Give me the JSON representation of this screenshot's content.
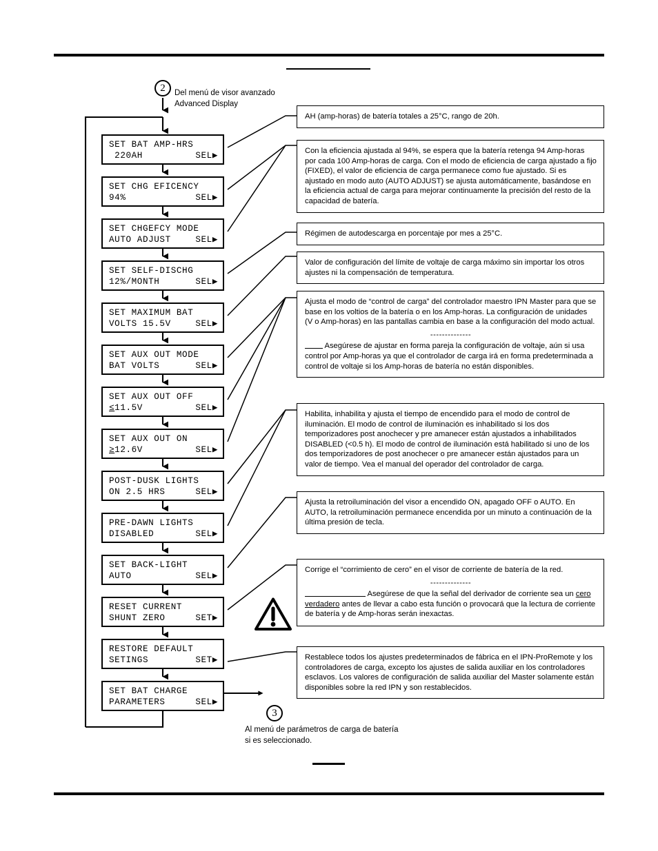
{
  "page": {
    "entry_marker": "2",
    "exit_marker": "3",
    "entry_caption": "Del menú de visor avanzado\nAdvanced Display",
    "exit_caption": "Al menú de parámetros de carga de batería\nsi es seleccionado."
  },
  "lcd_screens": [
    {
      "name": "set-bat-amp-hrs",
      "line1": "SET BAT AMP-HRS",
      "line2_prefix": "",
      "line2": " 220AH",
      "action": "SEL▶"
    },
    {
      "name": "set-chg-eficency",
      "line1": "SET CHG EFICENCY",
      "line2_prefix": "",
      "line2": "94%",
      "action": "SEL▶"
    },
    {
      "name": "set-chgefcy-mode",
      "line1": "SET CHGEFCY MODE",
      "line2_prefix": "",
      "line2": "AUTO ADJUST",
      "action": "SEL▶"
    },
    {
      "name": "set-self-dischg",
      "line1": "SET SELF-DISCHG",
      "line2_prefix": "",
      "line2": "12%/MONTH",
      "action": "SEL▶"
    },
    {
      "name": "set-maximum-bat",
      "line1": "SET MAXIMUM BAT",
      "line2_prefix": "",
      "line2": "VOLTS 15.5V",
      "action": "SEL▶"
    },
    {
      "name": "set-aux-out-mode",
      "line1": "SET AUX OUT MODE",
      "line2_prefix": "",
      "line2": "BAT VOLTS",
      "action": "SEL▶"
    },
    {
      "name": "set-aux-out-off",
      "line1": "SET AUX OUT OFF",
      "line2_prefix": "≤",
      "line2": "11.5V",
      "action": "SEL▶"
    },
    {
      "name": "set-aux-out-on",
      "line1": "SET AUX OUT ON",
      "line2_prefix": "≥",
      "line2": "12.6V",
      "action": "SEL▶"
    },
    {
      "name": "post-dusk-lights",
      "line1": "POST-DUSK LIGHTS",
      "line2_prefix": "",
      "line2": "ON 2.5 HRS",
      "action": "SEL▶"
    },
    {
      "name": "pre-dawn-lights",
      "line1": "PRE-DAWN LIGHTS",
      "line2_prefix": "",
      "line2": "DISABLED",
      "action": "SEL▶"
    },
    {
      "name": "set-back-light",
      "line1": "SET BACK-LIGHT",
      "line2_prefix": "",
      "line2": "AUTO",
      "action": "SEL▶"
    },
    {
      "name": "reset-current-shunt",
      "line1": "RESET CURRENT",
      "line2_prefix": "",
      "line2": "SHUNT ZERO",
      "action": "SET▶"
    },
    {
      "name": "restore-default",
      "line1": "RESTORE DEFAULT",
      "line2_prefix": "",
      "line2": "SETINGS",
      "action": "SET▶"
    },
    {
      "name": "set-bat-charge",
      "line1": "SET BAT CHARGE",
      "line2_prefix": "",
      "line2": "PARAMETERS",
      "action": "SEL▶"
    }
  ],
  "descriptions": {
    "amp_hours": {
      "p1": "AH (amp-horas) de batería totales a 25°C, rango de 20h."
    },
    "charge_efficiency": {
      "p1": "Con la eficiencia ajustada al 94%, se espera que la batería retenga 94 Amp-horas por cada 100 Amp-horas de carga. Con el modo de eficiencia de carga ajustado a fijo (FIXED), el valor de eficiencia de carga permanece como fue ajustado. Si es ajustado en modo auto (AUTO ADJUST) se ajusta automáticamente, basándose en la eficiencia actual de carga para mejorar continuamente la precisión del resto de la capacidad de batería."
    },
    "self_discharge": {
      "p1": "Régimen de autodescarga en porcentaje por mes a 25°C."
    },
    "maximum_bat_volts": {
      "p1": "Valor de configuración del límite de voltaje de carga máximo sin importar los otros ajustes ni la compensación de temperatura."
    },
    "aux_out_mode": {
      "p1": "Ajusta el modo de “control de carga” del controlador maestro IPN Master para que se base en los voltios de la batería o en los Amp-horas. La configuración de unidades (V o Amp-horas) en las pantallas cambia en base a la configuración del modo actual.",
      "separator": "--------------",
      "p2": "Asegúrese de ajustar en forma pareja la configuración de voltaje, aún si usa control por Amp-horas ya que el controlador de carga irá en forma predeterminada a control de voltaje si los Amp-horas de batería no están disponibles."
    },
    "lights_control": {
      "p1": "Habilita, inhabilita y ajusta el tiempo de encendido para el modo de control de iluminación. El modo de control de iluminación es inhabilitado si los dos temporizadores post anochecer y pre amanecer están ajustados a inhabilitados DISABLED (<0.5 h). El modo de control de iluminación está habilitado si uno de los dos temporizadores de post anochecer o pre amanecer están ajustados para un valor de tiempo. Vea el manual del operador del controlador de carga."
    },
    "back_light": {
      "p1": "Ajusta la retroiluminación del visor a encendido ON, apagado OFF o AUTO. En AUTO, la retroiluminación permanece encendida por un minuto a continuación de la última presión de tecla."
    },
    "shunt_zero": {
      "p1": "Corrige el “corrimiento de cero” en el visor de corriente de batería de la red.",
      "separator": "--------------",
      "p2_a": "Asegúrese de que la señal del derivador de corriente sea un ",
      "p2_underlined": "cero verdadero",
      "p2_b": " antes de llevar a cabo esta función o provocará que la lectura de corriente de batería y de Amp-horas serán inexactas."
    },
    "restore_defaults": {
      "p1": "Restablece todos los ajustes predeterminados de fábrica en el IPN-ProRemote y los controladores de carga, excepto los ajustes de salida auxiliar en los controladores esclavos. Los valores de configuración de salida auxiliar del Master solamente están disponibles sobre la red IPN y son restablecidos."
    }
  }
}
